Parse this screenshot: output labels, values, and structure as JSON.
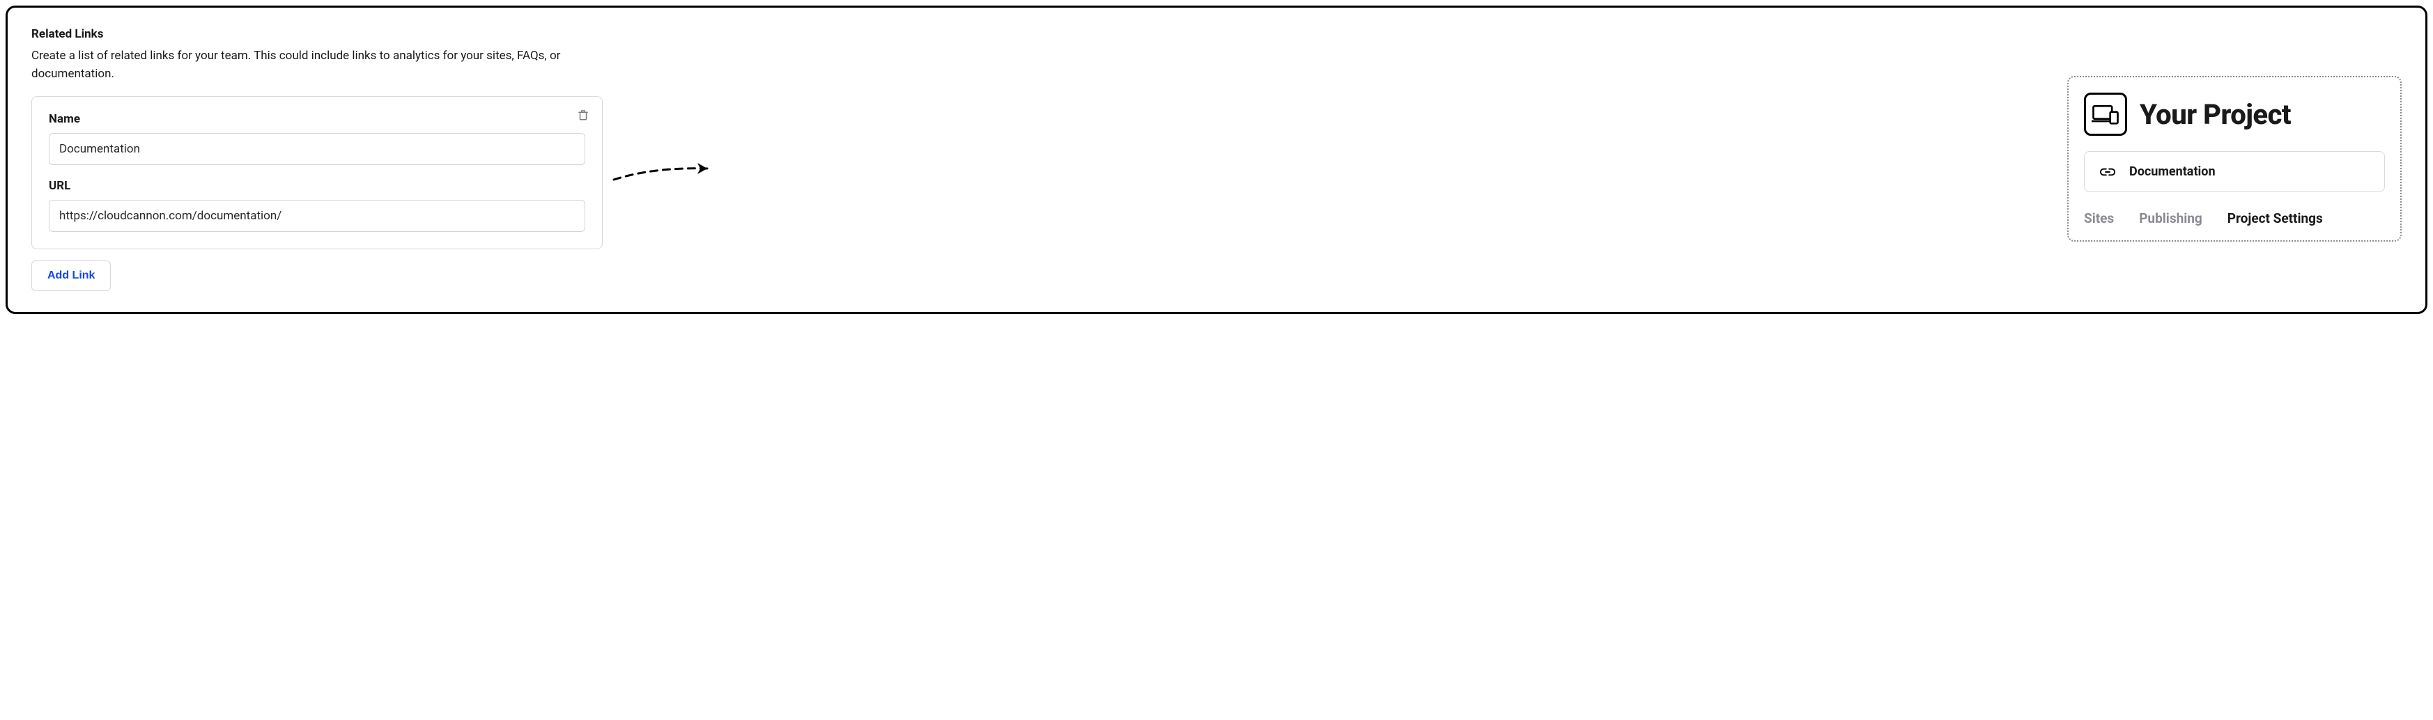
{
  "section": {
    "title": "Related Links",
    "description": "Create a list of related links for your team. This could include links to analytics for your sites, FAQs, or documentation."
  },
  "link_item": {
    "name_label": "Name",
    "name_value": "Documentation",
    "url_label": "URL",
    "url_value": "https://cloudcannon.com/documentation/"
  },
  "buttons": {
    "add_link": "Add Link"
  },
  "preview": {
    "project_title": "Your Project",
    "doc_link_label": "Documentation",
    "tabs": {
      "sites": "Sites",
      "publishing": "Publishing",
      "project_settings": "Project Settings"
    }
  }
}
